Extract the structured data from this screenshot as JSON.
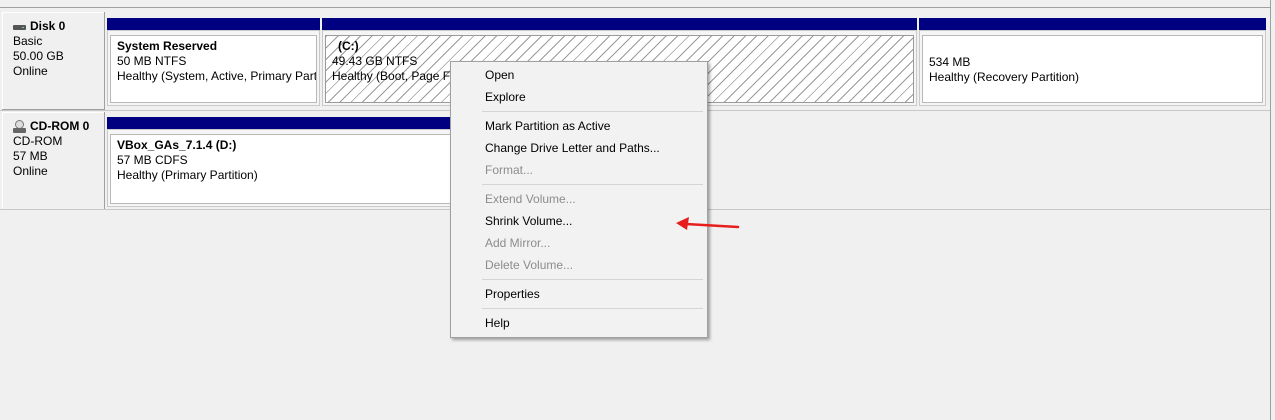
{
  "disks": [
    {
      "icon": "hard-disk-icon",
      "name": "Disk 0",
      "type": "Basic",
      "size": "50.00 GB",
      "status": "Online",
      "volumes": [
        {
          "title": "System Reserved",
          "size_fs": "50 MB NTFS",
          "status": "Healthy (System, Active, Primary Partiti"
        },
        {
          "title": "(C:)",
          "size_fs": "49.43 GB NTFS",
          "status": "Healthy (Boot, Page File"
        },
        {
          "title": "",
          "size_fs": "534 MB",
          "status": "Healthy (Recovery Partition)"
        }
      ]
    },
    {
      "icon": "cd-rom-icon",
      "name": "CD-ROM 0",
      "type": "CD-ROM",
      "size": "57 MB",
      "status": "Online",
      "volumes": [
        {
          "title": "VBox_GAs_7.1.4  (D:)",
          "size_fs": "57 MB CDFS",
          "status": "Healthy (Primary Partition)"
        }
      ]
    }
  ],
  "context_menu": {
    "items": [
      {
        "label": "Open",
        "enabled": true
      },
      {
        "label": "Explore",
        "enabled": true
      },
      {
        "separator": true
      },
      {
        "label": "Mark Partition as Active",
        "enabled": true
      },
      {
        "label": "Change Drive Letter and Paths...",
        "enabled": true
      },
      {
        "label": "Format...",
        "enabled": false
      },
      {
        "separator": true
      },
      {
        "label": "Extend Volume...",
        "enabled": false
      },
      {
        "label": "Shrink Volume...",
        "enabled": true
      },
      {
        "label": "Add Mirror...",
        "enabled": false
      },
      {
        "label": "Delete Volume...",
        "enabled": false
      },
      {
        "separator": true
      },
      {
        "label": "Properties",
        "enabled": true
      },
      {
        "separator": true
      },
      {
        "label": "Help",
        "enabled": true
      }
    ]
  },
  "annotation": {
    "icon": "red-arrow-icon",
    "color": "#e81e1e",
    "points_to": "Shrink Volume..."
  },
  "colors": {
    "volume_header": "#000080",
    "background": "#f0f0f0",
    "disabled_text": "#8c8c8c"
  }
}
